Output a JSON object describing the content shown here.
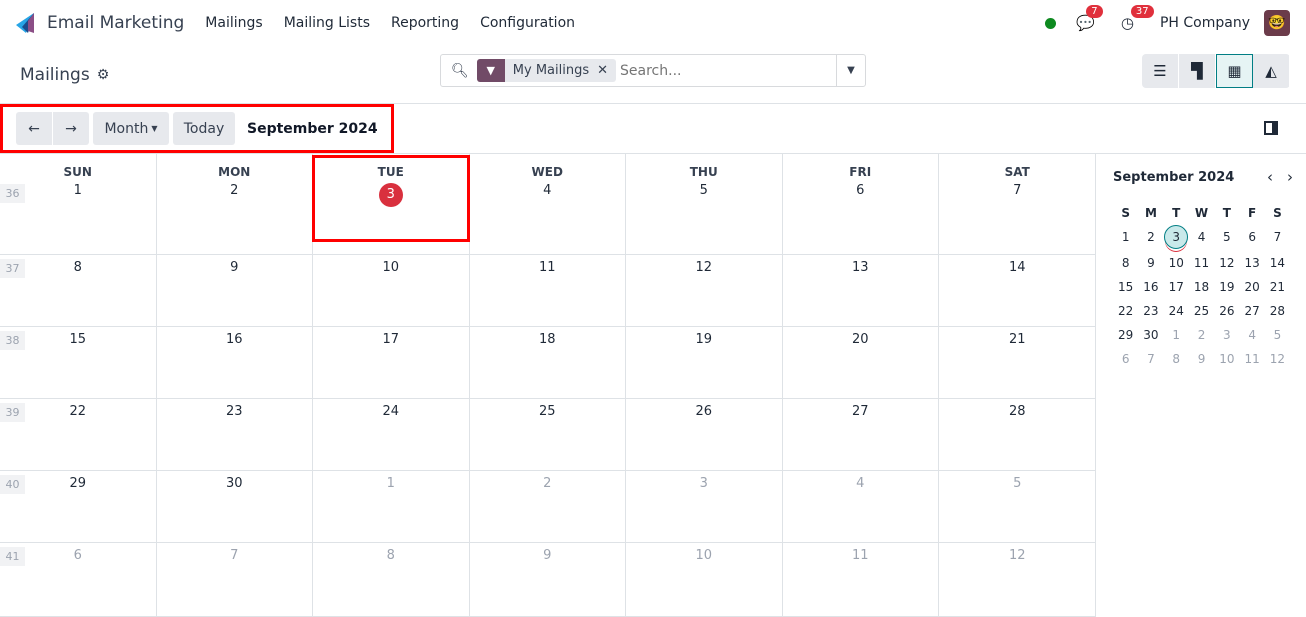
{
  "nav": {
    "app": "Email Marketing",
    "menus": [
      "Mailings",
      "Mailing Lists",
      "Reporting",
      "Configuration"
    ],
    "messages_count": "7",
    "activities_count": "37",
    "company": "PH Company",
    "status_color": "#0d8a1f"
  },
  "control": {
    "title": "Mailings",
    "search": {
      "facet": "My Mailings",
      "placeholder": "Search..."
    },
    "views": [
      "list",
      "kanban",
      "calendar",
      "graph"
    ],
    "active_view": "calendar"
  },
  "toolbar": {
    "prev": "←",
    "next": "→",
    "scale": "Month",
    "today": "Today",
    "period": "September 2024"
  },
  "calendar": {
    "day_headers": [
      "SUN",
      "MON",
      "TUE",
      "WED",
      "THU",
      "FRI",
      "SAT"
    ],
    "today": "3",
    "weeks": [
      {
        "num": "36",
        "days": [
          {
            "d": "1"
          },
          {
            "d": "2"
          },
          {
            "d": "3",
            "today": true
          },
          {
            "d": "4"
          },
          {
            "d": "5"
          },
          {
            "d": "6"
          },
          {
            "d": "7"
          }
        ]
      },
      {
        "num": "37",
        "days": [
          {
            "d": "8"
          },
          {
            "d": "9"
          },
          {
            "d": "10"
          },
          {
            "d": "11"
          },
          {
            "d": "12"
          },
          {
            "d": "13"
          },
          {
            "d": "14"
          }
        ]
      },
      {
        "num": "38",
        "days": [
          {
            "d": "15"
          },
          {
            "d": "16"
          },
          {
            "d": "17"
          },
          {
            "d": "18"
          },
          {
            "d": "19"
          },
          {
            "d": "20"
          },
          {
            "d": "21"
          }
        ]
      },
      {
        "num": "39",
        "days": [
          {
            "d": "22"
          },
          {
            "d": "23"
          },
          {
            "d": "24"
          },
          {
            "d": "25"
          },
          {
            "d": "26"
          },
          {
            "d": "27"
          },
          {
            "d": "28"
          }
        ]
      },
      {
        "num": "40",
        "days": [
          {
            "d": "29"
          },
          {
            "d": "30"
          },
          {
            "d": "1",
            "muted": true
          },
          {
            "d": "2",
            "muted": true
          },
          {
            "d": "3",
            "muted": true
          },
          {
            "d": "4",
            "muted": true
          },
          {
            "d": "5",
            "muted": true
          }
        ]
      },
      {
        "num": "41",
        "days": [
          {
            "d": "6",
            "muted": true
          },
          {
            "d": "7",
            "muted": true
          },
          {
            "d": "8",
            "muted": true
          },
          {
            "d": "9",
            "muted": true
          },
          {
            "d": "10",
            "muted": true
          },
          {
            "d": "11",
            "muted": true
          },
          {
            "d": "12",
            "muted": true
          }
        ]
      }
    ]
  },
  "mini": {
    "title": "September 2024",
    "day_headers": [
      "S",
      "M",
      "T",
      "W",
      "T",
      "F",
      "S"
    ]
  }
}
